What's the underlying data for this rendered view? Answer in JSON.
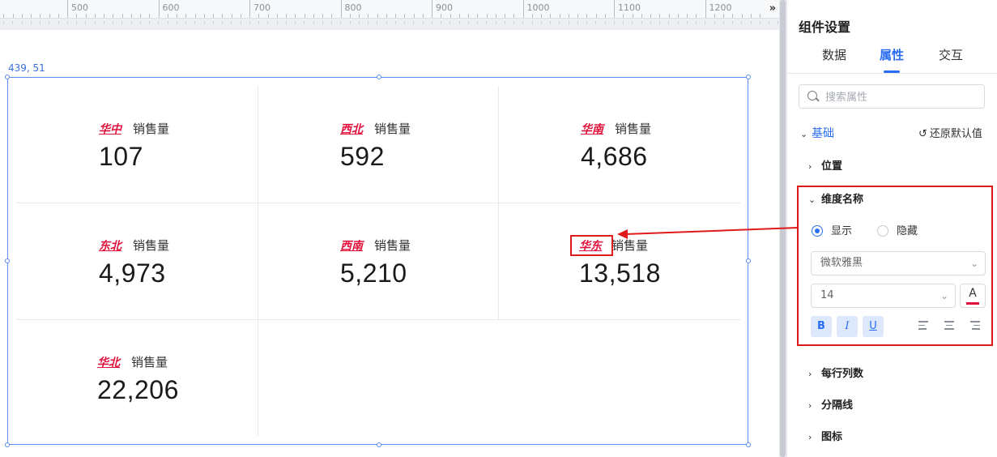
{
  "ruler": {
    "labels": [
      "500",
      "600",
      "700",
      "800",
      "900",
      "1000",
      "1100",
      "1200"
    ],
    "toggle": "»"
  },
  "canvas": {
    "coords": "439, 51",
    "metric_label": "销售量",
    "cells": [
      {
        "region": "华中",
        "value": "107"
      },
      {
        "region": "西北",
        "value": "592"
      },
      {
        "region": "华南",
        "value": "4,686"
      },
      {
        "region": "东北",
        "value": "4,973"
      },
      {
        "region": "西南",
        "value": "5,210"
      },
      {
        "region": "华东",
        "value": "13,518"
      },
      {
        "region": "华北",
        "value": "22,206"
      }
    ]
  },
  "panel": {
    "title": "组件设置",
    "tabs": [
      "数据",
      "属性",
      "交互"
    ],
    "search_placeholder": "搜索属性",
    "group": "基础",
    "reset": "还原默认值",
    "sections": {
      "position": "位置",
      "dimension_name": "维度名称",
      "columns_per_row": "每行列数",
      "divider": "分隔线",
      "icon": "图标"
    },
    "radio_show": "显示",
    "radio_hide": "隐藏",
    "font_family": "微软雅黑",
    "font_size": "14",
    "color_letter": "A",
    "bold": "B",
    "italic": "I",
    "underline": "U"
  },
  "colors": {
    "accent": "#2a6df4",
    "region_text": "#e0103a",
    "annotation": "#e01a1a"
  }
}
